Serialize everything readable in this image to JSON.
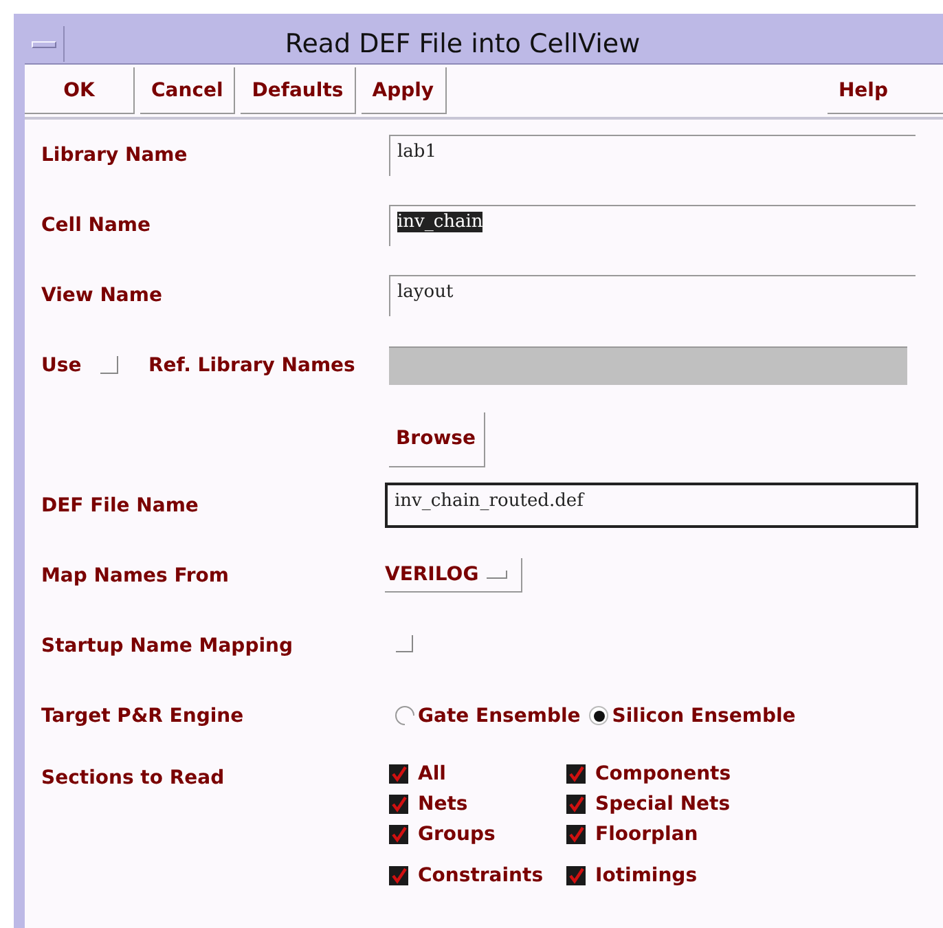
{
  "window": {
    "title": "Read DEF File into CellView"
  },
  "buttons": [
    {
      "label": "OK"
    },
    {
      "label": "Cancel"
    },
    {
      "label": "Defaults"
    },
    {
      "label": "Apply"
    }
  ],
  "help": {
    "label": "Help"
  },
  "rows": [
    {
      "kind": "text",
      "label": "Library Name",
      "value": "lab1",
      "highlighted": false,
      "focused": false
    },
    {
      "kind": "text",
      "label": "Cell Name",
      "value": "inv_chain",
      "highlighted": true,
      "focused": false
    },
    {
      "kind": "text",
      "label": "View Name",
      "value": "layout",
      "highlighted": false,
      "focused": false
    },
    {
      "kind": "use",
      "label": "Use",
      "checked": false,
      "label2": "Ref. Library Names",
      "disabled": true
    },
    {
      "kind": "button",
      "label": "Browse"
    },
    {
      "kind": "text",
      "label": "DEF File Name",
      "value": "inv_chain_routed.def",
      "highlighted": false,
      "focused": true
    },
    {
      "kind": "dropdown",
      "label": "Map Names From",
      "value": "VERILOG"
    },
    {
      "kind": "checkbox",
      "label": "Startup Name Mapping",
      "checked": false
    },
    {
      "kind": "radio",
      "label": "Target P&R Engine",
      "options": [
        {
          "label": "Gate Ensemble",
          "selected": false
        },
        {
          "label": "Silicon Ensemble",
          "selected": true
        }
      ]
    },
    {
      "kind": "checks",
      "label": "Sections to Read",
      "groups": [
        [
          {
            "label": "All",
            "checked": true
          },
          {
            "label": "Components",
            "checked": true
          },
          {
            "label": "Nets",
            "checked": true
          },
          {
            "label": "Special Nets",
            "checked": true
          },
          {
            "label": "Groups",
            "checked": true
          },
          {
            "label": "Floorplan",
            "checked": true
          }
        ],
        [
          {
            "label": "Constraints",
            "checked": true
          },
          {
            "label": "Iotimings",
            "checked": true
          }
        ]
      ]
    }
  ]
}
